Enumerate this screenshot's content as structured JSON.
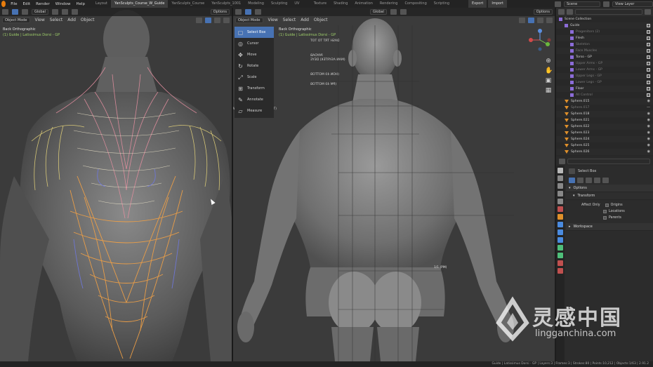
{
  "menu": {
    "items": [
      "File",
      "Edit",
      "Render",
      "Window",
      "Help"
    ],
    "workspaces": [
      "Layout",
      "YanSculpts_Course_W_Guide",
      "YanSculpts_Course",
      "YanSculpts_1001",
      "Modeling",
      "Sculpting 001",
      "UV Editing",
      "Texture Paint",
      "Shading",
      "Animation",
      "Rendering",
      "Compositing",
      "Scripting"
    ],
    "active_workspace": 1,
    "export": "Export",
    "import": "Import",
    "scene": "Scene",
    "view_layer": "View Layer"
  },
  "left_viewport": {
    "transform": "Global",
    "options": "Options",
    "mode": "Object Mode",
    "menus": [
      "View",
      "Select",
      "Add",
      "Object"
    ],
    "view_name": "Back Orthographic",
    "object_name": "(1) Guide | Latissimus Dorsi - GP"
  },
  "right_viewport": {
    "transform": "Global",
    "options": "Options",
    "mode": "Object Mode",
    "menus": [
      "View",
      "Select",
      "Add",
      "Object"
    ],
    "view_name": "Back Orthographic",
    "object_name": "(1) Guide | Latissimus Dorsi - GP"
  },
  "toolbar": {
    "tools": [
      {
        "label": "Select Box",
        "icon": "select-box-icon"
      },
      {
        "label": "Cursor",
        "icon": "cursor-icon"
      },
      {
        "label": "Move",
        "icon": "move-icon"
      },
      {
        "label": "Rotate",
        "icon": "rotate-icon"
      },
      {
        "label": "Scale",
        "icon": "scale-icon"
      },
      {
        "label": "Transform",
        "icon": "transform-icon"
      },
      {
        "label": "Annotate",
        "icon": "annotate-icon"
      },
      {
        "label": "Measure",
        "icon": "measure-icon"
      }
    ],
    "active": 0
  },
  "mirrored_text": [
    "DASH TRT TO TOT",
    "PAYOAB",
    "(MAN ASYRTEK) DEYE",
    "(HON 40 MOTTOB",
    "(PM 40 MOTTOB",
    "(T&T 1 TPAOAM 04 HTOBW"
  ],
  "measure_label": "1/1 (PM)",
  "outliner": {
    "title": "Scene Collection",
    "rows": [
      {
        "label": "Scene Collection",
        "indent": 0,
        "type": "collection",
        "dim": false,
        "vis": "none"
      },
      {
        "label": "Guide",
        "indent": 1,
        "type": "collection",
        "dim": false,
        "vis": "check"
      },
      {
        "label": "Progenitors (2)",
        "indent": 2,
        "type": "collection",
        "dim": true,
        "vis": "check"
      },
      {
        "label": "Flesh",
        "indent": 2,
        "type": "collection",
        "dim": false,
        "vis": "check"
      },
      {
        "label": "Skeleton",
        "indent": 2,
        "type": "collection",
        "dim": true,
        "vis": "check"
      },
      {
        "label": "Face Muscles",
        "indent": 2,
        "type": "collection",
        "dim": true,
        "vis": "check"
      },
      {
        "label": "Torso - GP",
        "indent": 2,
        "type": "collection",
        "dim": false,
        "vis": "check"
      },
      {
        "label": "Upper Arms - GP",
        "indent": 2,
        "type": "collection",
        "dim": true,
        "vis": "check"
      },
      {
        "label": "Lower Arms - GP",
        "indent": 2,
        "type": "collection",
        "dim": true,
        "vis": "check"
      },
      {
        "label": "Upper Legs - GP",
        "indent": 2,
        "type": "collection",
        "dim": true,
        "vis": "check"
      },
      {
        "label": "Lower Legs - GP",
        "indent": 2,
        "type": "collection",
        "dim": true,
        "vis": "check"
      },
      {
        "label": "Floor",
        "indent": 2,
        "type": "collection",
        "dim": false,
        "vis": "check"
      },
      {
        "label": "All Control",
        "indent": 2,
        "type": "collection",
        "dim": true,
        "vis": "check"
      },
      {
        "label": "Sphere.015",
        "indent": 1,
        "type": "mesh",
        "dim": false,
        "vis": "eye"
      },
      {
        "label": "Sphere.017",
        "indent": 1,
        "type": "mesh",
        "dim": true,
        "vis": "eye-off"
      },
      {
        "label": "Sphere.018",
        "indent": 1,
        "type": "mesh",
        "dim": false,
        "vis": "eye"
      },
      {
        "label": "Sphere.021",
        "indent": 1,
        "type": "mesh",
        "dim": false,
        "vis": "eye"
      },
      {
        "label": "Sphere.022",
        "indent": 1,
        "type": "mesh",
        "dim": false,
        "vis": "eye"
      },
      {
        "label": "Sphere.023",
        "indent": 1,
        "type": "mesh",
        "dim": false,
        "vis": "eye"
      },
      {
        "label": "Sphere.024",
        "indent": 1,
        "type": "mesh",
        "dim": false,
        "vis": "eye"
      },
      {
        "label": "Sphere.025",
        "indent": 1,
        "type": "mesh",
        "dim": false,
        "vis": "eye"
      },
      {
        "label": "Sphere.026",
        "indent": 1,
        "type": "mesh",
        "dim": false,
        "vis": "eye"
      }
    ]
  },
  "properties": {
    "tool_name": "Select Box",
    "options_label": "Options",
    "transform_label": "Transform",
    "affect_only_label": "Affect Only",
    "affect_options": [
      "Origins",
      "Locations",
      "Parents"
    ],
    "workspace_label": "Workspace"
  },
  "status": "Guide | Latissimus Dorsi - GP | Layers:3 | Frames:3 | Strokes:80 | Points:10,212 | Objects:1/63 | 2.91.2",
  "watermark": {
    "cn": "灵感中国",
    "en": "lingganchina.com"
  },
  "colors": {
    "accent": "#4772b3",
    "orange": "#e87d0d",
    "collection_purple": "#8c6cd8",
    "mesh_orange": "#e0902a",
    "gp_green": "#4fbf7a"
  }
}
